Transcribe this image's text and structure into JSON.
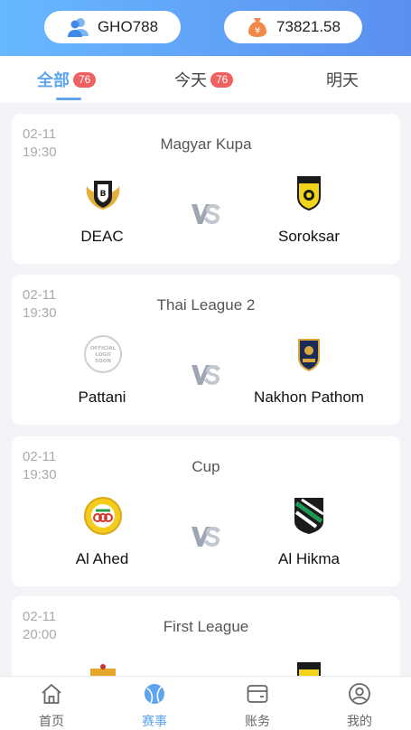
{
  "header": {
    "username": "GHO788",
    "balance": "73821.58",
    "user_icon": "user-group-icon",
    "balance_icon": "money-bag-icon"
  },
  "tabs": [
    {
      "label": "全部",
      "count": "76",
      "active": true
    },
    {
      "label": "今天",
      "count": "76"
    },
    {
      "label": "明天"
    }
  ],
  "matches": [
    {
      "date": "02-11",
      "time": "19:30",
      "league": "Magyar Kupa",
      "home": "DEAC",
      "away": "Soroksar",
      "home_logo": "deac-crest-icon",
      "away_logo": "soroksar-crest-icon"
    },
    {
      "date": "02-11",
      "time": "19:30",
      "league": "Thai League 2",
      "home": "Pattani",
      "away": "Nakhon Pathom",
      "home_logo": "official-logo-soon-icon",
      "away_logo": "nakhon-pathom-crest-icon"
    },
    {
      "date": "02-11",
      "time": "19:30",
      "league": "Cup",
      "home": "Al Ahed",
      "away": "Al Hikma",
      "home_logo": "al-ahed-crest-icon",
      "away_logo": "al-hikma-crest-icon"
    },
    {
      "date": "02-11",
      "time": "20:00",
      "league": "First League",
      "home": "",
      "away": "",
      "home_logo": "crest-icon",
      "away_logo": "crest-icon"
    }
  ],
  "logo_text": {
    "official_soon": [
      "OFFICIAL",
      "LOGO",
      "SOON"
    ]
  },
  "nav": [
    {
      "label": "首页",
      "icon": "home-icon"
    },
    {
      "label": "赛事",
      "icon": "ball-icon",
      "active": true
    },
    {
      "label": "账务",
      "icon": "wallet-icon"
    },
    {
      "label": "我的",
      "icon": "profile-icon"
    }
  ],
  "colors": {
    "accent": "#5ea4ee",
    "badge": "#f06060",
    "header_start": "#67b8ff",
    "header_end": "#5a8ff0"
  }
}
